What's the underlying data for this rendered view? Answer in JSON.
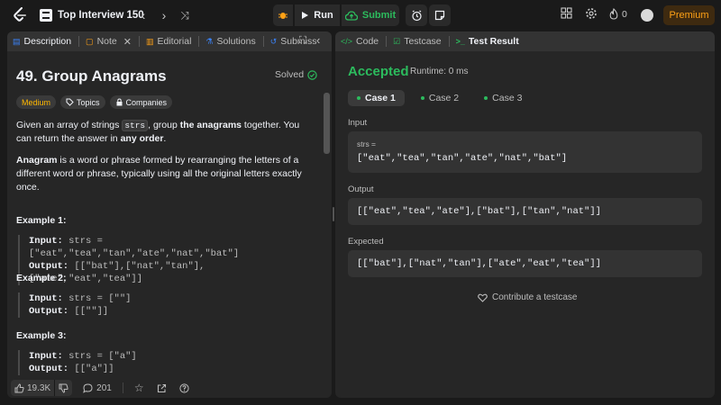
{
  "topbar": {
    "problem_list_title": "Top Interview 150",
    "run_label": "Run",
    "submit_label": "Submit",
    "coins": "0",
    "premium_label": "Premium"
  },
  "left_panel": {
    "tabs": [
      {
        "label": "Description"
      },
      {
        "label": "Note"
      },
      {
        "label": "Editorial"
      },
      {
        "label": "Solutions"
      },
      {
        "label": "Submiss"
      }
    ],
    "title": "49. Group Anagrams",
    "status": "Solved",
    "badges": {
      "difficulty": "Medium",
      "topics": "Topics",
      "companies": "Companies"
    },
    "para1": {
      "a": "Given an array of strings ",
      "code": "strs",
      "b": ", group ",
      "c": "the anagrams",
      "d": " together. You can return the answer in ",
      "e": "any order",
      "f": "."
    },
    "para2": {
      "a": "Anagram",
      "b": " is a word or phrase formed by rearranging the letters of a different word or phrase, typically using all the original letters exactly once."
    },
    "examples": [
      {
        "title": "Example 1:",
        "input_label": "Input:",
        "input": "strs = [\"eat\",\"tea\",\"tan\",\"ate\",\"nat\",\"bat\"]",
        "output_label": "Output:",
        "output": "[[\"bat\"],[\"nat\",\"tan\"],[\"ate\",\"eat\",\"tea\"]]"
      },
      {
        "title": "Example 2:",
        "input_label": "Input:",
        "input": "strs = [\"\"]",
        "output_label": "Output:",
        "output": "[[\"\"]]"
      },
      {
        "title": "Example 3:",
        "input_label": "Input:",
        "input": "strs = [\"a\"]",
        "output_label": "Output:",
        "output": "[[\"a\"]]"
      }
    ],
    "bottom": {
      "likes": "19.3K",
      "comments": "201"
    }
  },
  "right_panel": {
    "tabs": [
      {
        "label": "Code"
      },
      {
        "label": "Testcase"
      },
      {
        "label": "Test Result"
      }
    ],
    "result": "Accepted",
    "runtime": "Runtime: 0 ms",
    "cases": [
      {
        "label": "Case 1"
      },
      {
        "label": "Case 2"
      },
      {
        "label": "Case 3"
      }
    ],
    "input_label": "Input",
    "input_var": "strs =",
    "input_value": "[\"eat\",\"tea\",\"tan\",\"ate\",\"nat\",\"bat\"]",
    "output_label": "Output",
    "output_value": "[[\"eat\",\"tea\",\"ate\"],[\"bat\"],[\"tan\",\"nat\"]]",
    "expected_label": "Expected",
    "expected_value": "[[\"bat\"],[\"nat\",\"tan\"],[\"ate\",\"eat\",\"tea\"]]",
    "contribute_label": "Contribute a testcase"
  },
  "colors": {
    "accent_green": "#2cbb5d",
    "premium_orange": "#ffa116",
    "medium_yellow": "#ffb800",
    "panel_bg": "#262626"
  },
  "icons": [
    "leetcode-logo-icon",
    "list-icon",
    "chevron-left-icon",
    "chevron-right-icon",
    "shuffle-icon",
    "debug-icon",
    "play-icon",
    "cloud-upload-icon",
    "timer-icon",
    "notes-icon",
    "layout-icon",
    "gear-icon",
    "fire-icon",
    "avatar-icon",
    "thumbs-up-icon",
    "thumbs-down-icon",
    "comment-icon",
    "star-icon",
    "share-icon",
    "help-icon",
    "heart-icon"
  ]
}
